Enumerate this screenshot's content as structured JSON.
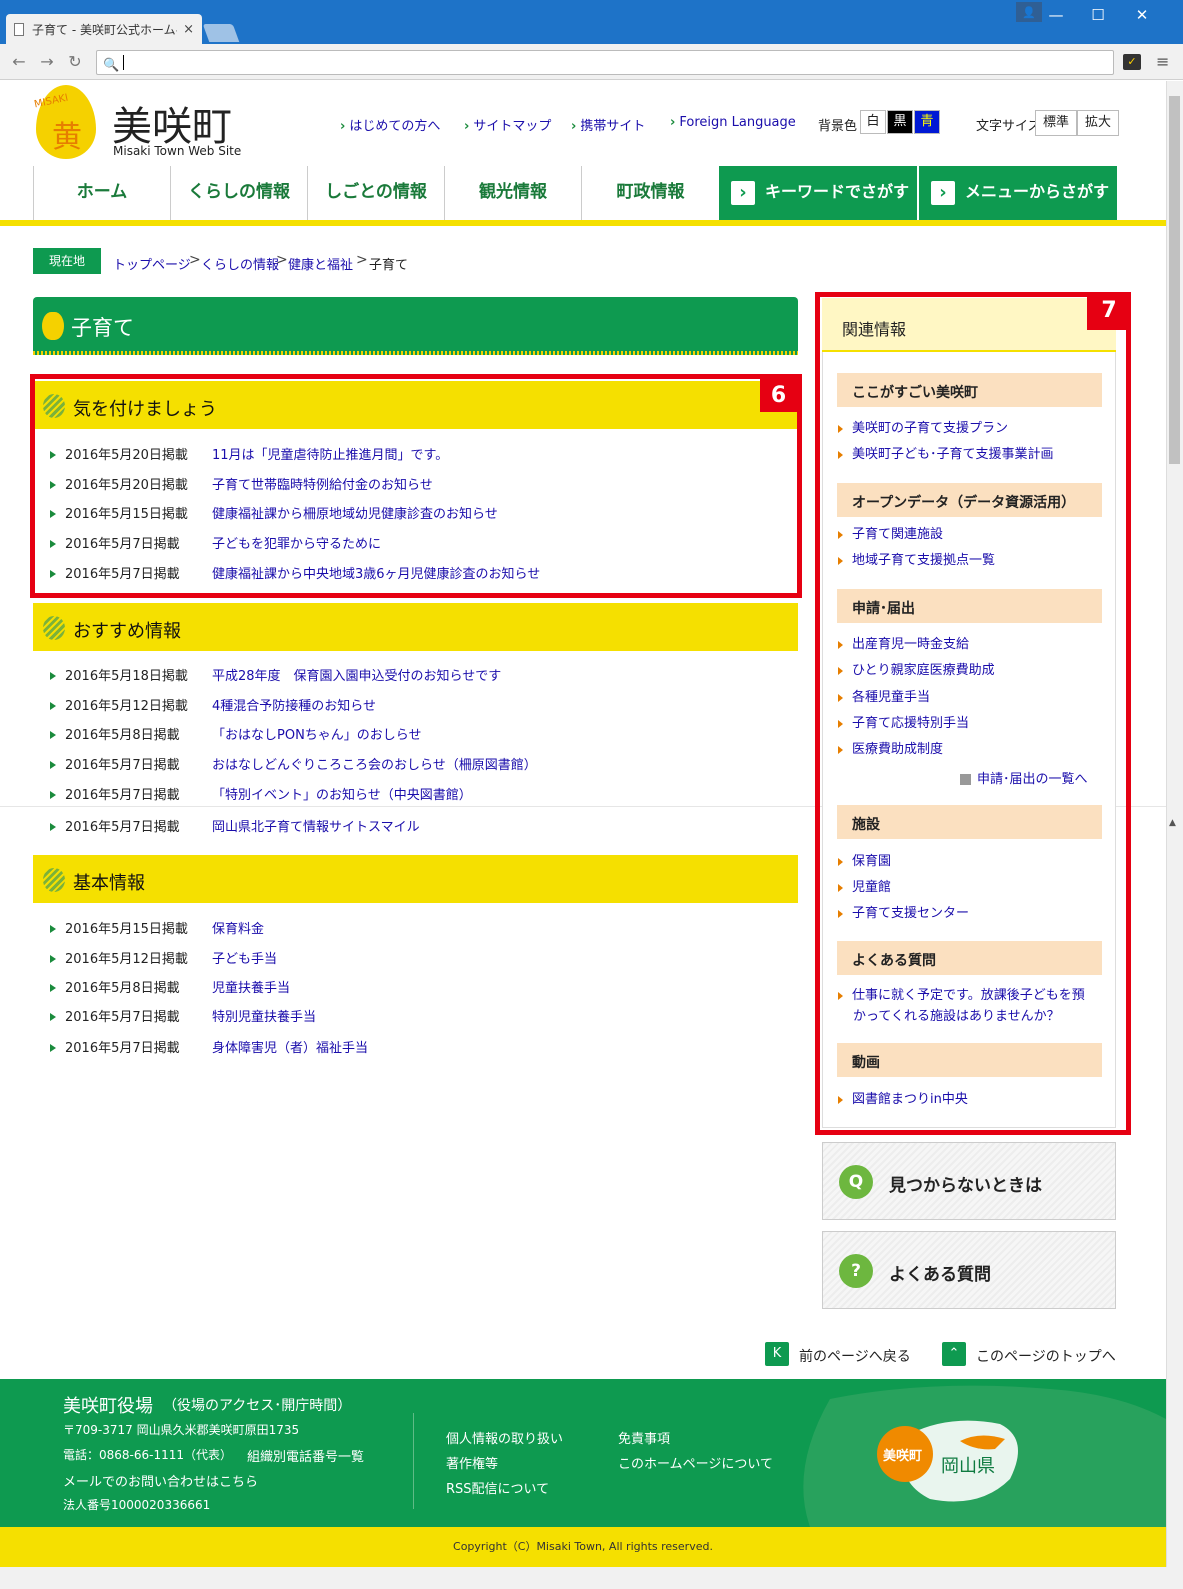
{
  "browser": {
    "tab_title": "子育て - 美咲町公式ホームペ",
    "tab_close": "×",
    "min": "—",
    "max": "☐",
    "close": "✕",
    "user": "👤",
    "back": "←",
    "forward": "→",
    "reload": "↻",
    "search_icon": "🔍",
    "ext": "✓",
    "menu": "≡"
  },
  "header": {
    "logo_kanji": "黄",
    "logo_word": "MISAKI",
    "site_name": "美咲町",
    "site_sub": "Misaki Town Web Site",
    "util": [
      "はじめての方へ",
      "サイトマップ",
      "携帯サイト",
      "Foreign Language"
    ],
    "bg_label": "背景色",
    "bg": [
      "白",
      "黒",
      "青"
    ],
    "fs_label": "文字サイズ",
    "fs": [
      "標準",
      "拡大"
    ]
  },
  "gnav": {
    "items": [
      "ホーム",
      "くらしの情報",
      "しごとの情報",
      "観光情報",
      "町政情報"
    ],
    "keyword": "キーワードでさがす",
    "menu": "メニューからさがす",
    "chev": "›"
  },
  "breadcrumb": {
    "tag": "現在地",
    "links": [
      "トップページ",
      "くらしの情報",
      "健康と福祉"
    ],
    "current": "子育て",
    "sep": ">"
  },
  "title": "子育て",
  "sections": [
    {
      "title": "気を付けましょう",
      "rows": [
        {
          "date": "2016年5月20日掲載",
          "link": "11月は「児童虐待防止推進月間」です。"
        },
        {
          "date": "2016年5月20日掲載",
          "link": "子育て世帯臨時特例給付金のお知らせ"
        },
        {
          "date": "2016年5月15日掲載",
          "link": "健康福祉課から柵原地域幼児健康診査のお知らせ"
        },
        {
          "date": "2016年5月7日掲載",
          "link": "子どもを犯罪から守るために"
        },
        {
          "date": "2016年5月7日掲載",
          "link": "健康福祉課から中央地域3歳6ヶ月児健康診査のお知らせ"
        }
      ]
    },
    {
      "title": "おすすめ情報",
      "rows": [
        {
          "date": "2016年5月18日掲載",
          "link": "平成28年度　保育園入園申込受付のお知らせです"
        },
        {
          "date": "2016年5月12日掲載",
          "link": "4種混合予防接種のお知らせ"
        },
        {
          "date": "2016年5月8日掲載",
          "link": "「おはなしPONちゃん」のおしらせ"
        },
        {
          "date": "2016年5月7日掲載",
          "link": "おはなしどんぐりころころ会のおしらせ（柵原図書館）"
        },
        {
          "date": "2016年5月7日掲載",
          "link": "「特別イベント」のお知らせ（中央図書館）"
        },
        {
          "date": "2016年5月7日掲載",
          "link": "岡山県北子育て情報サイトスマイル"
        }
      ]
    },
    {
      "title": "基本情報",
      "rows": [
        {
          "date": "2016年5月15日掲載",
          "link": "保育料金"
        },
        {
          "date": "2016年5月12日掲載",
          "link": "子ども手当"
        },
        {
          "date": "2016年5月8日掲載",
          "link": "児童扶養手当"
        },
        {
          "date": "2016年5月7日掲載",
          "link": "特別児童扶養手当"
        },
        {
          "date": "2016年5月7日掲載",
          "link": "身体障害児（者）福祉手当"
        }
      ]
    }
  ],
  "badges": [
    "6",
    "7"
  ],
  "sidebar": {
    "title": "関連情報",
    "cats": [
      {
        "title": "ここがすごい美咲町",
        "links": [
          "美咲町の子育て支援プラン",
          "美咲町子ども･子育て支援事業計画"
        ]
      },
      {
        "title": "オープンデータ（データ資源活用）",
        "links": [
          "子育て関連施設",
          "地域子育て支援拠点一覧"
        ]
      },
      {
        "title": "申請･届出",
        "links": [
          "出産育児一時金支給",
          "ひとり親家庭医療費助成",
          "各種児童手当",
          "子育て応援特別手当",
          "医療費助成制度"
        ]
      },
      {
        "title": "施設",
        "links": [
          "保育園",
          "児童館",
          "子育て支援センター"
        ]
      },
      {
        "title": "よくある質問",
        "links": [
          "仕事に就く予定です。放課後子どもを預",
          "かってくれる施設はありませんか？"
        ]
      },
      {
        "title": "動画",
        "links": [
          "図書館まつりin中央"
        ]
      }
    ],
    "more": "申請･届出の一覧へ"
  },
  "buttons": [
    {
      "label": "見つからないときは",
      "icon": "Q"
    },
    {
      "label": "よくある質問",
      "icon": "?"
    }
  ],
  "pagenav": [
    {
      "label": "前のページへ戻る",
      "icon": "K"
    },
    {
      "label": "このページのトップへ",
      "icon": "⌃"
    }
  ],
  "footer": {
    "org": "美咲町役場",
    "access": "役場のアクセス･開庁時間",
    "addr": "〒709-3717  岡山県久米郡美咲町原田1735",
    "tel": "電話：0868-66-1111（代表）",
    "tel_link": "組織別電話番号一覧",
    "mail": "メールでのお問い合わせはこちら",
    "corp": "法人番号1000020336661",
    "links1": [
      "個人情報の取り扱い",
      "著作権等",
      "RSS配信について"
    ],
    "links2": [
      "免責事項",
      "このホームページについて"
    ],
    "map_town": "美咲町",
    "map_pref": "岡山県",
    "copyright": "Copyright（C）Misaki Town, All rights reserved."
  }
}
